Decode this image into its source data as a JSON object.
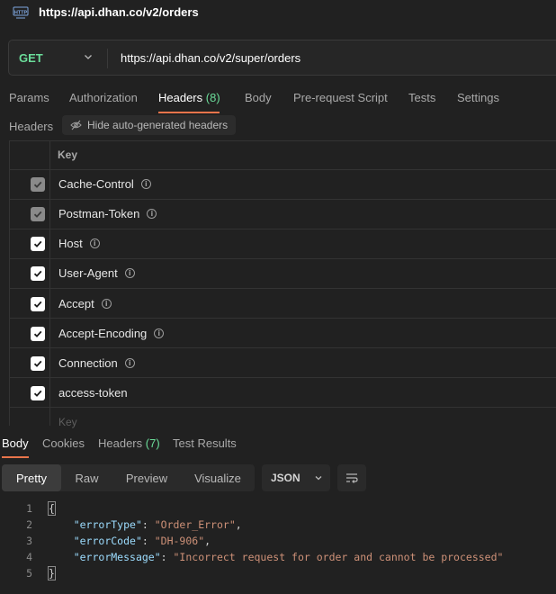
{
  "window": {
    "title": "https://api.dhan.co/v2/orders"
  },
  "request": {
    "method": "GET",
    "url": "https://api.dhan.co/v2/super/orders",
    "tabs": [
      {
        "label": "Params"
      },
      {
        "label": "Authorization"
      },
      {
        "label": "Headers",
        "count": "(8)"
      },
      {
        "label": "Body"
      },
      {
        "label": "Pre-request Script"
      },
      {
        "label": "Tests"
      },
      {
        "label": "Settings"
      }
    ],
    "active_tab": "Headers"
  },
  "headers_section": {
    "label": "Headers",
    "hide_button": "Hide auto-generated headers",
    "column_key": "Key",
    "rows": [
      {
        "key": "Cache-Control",
        "state": "dim",
        "info": true
      },
      {
        "key": "Postman-Token",
        "state": "dim",
        "info": true
      },
      {
        "key": "Host",
        "state": "on",
        "info": true
      },
      {
        "key": "User-Agent",
        "state": "on",
        "info": true
      },
      {
        "key": "Accept",
        "state": "on",
        "info": true
      },
      {
        "key": "Accept-Encoding",
        "state": "on",
        "info": true
      },
      {
        "key": "Connection",
        "state": "on",
        "info": true
      },
      {
        "key": "access-token",
        "state": "on",
        "info": false
      }
    ],
    "new_key_placeholder": "Key"
  },
  "response": {
    "tabs": [
      {
        "label": "Body"
      },
      {
        "label": "Cookies"
      },
      {
        "label": "Headers",
        "count": "(7)"
      },
      {
        "label": "Test Results"
      }
    ],
    "active_tab": "Body",
    "view_modes": [
      "Pretty",
      "Raw",
      "Preview",
      "Visualize"
    ],
    "active_view": "Pretty",
    "format": "JSON",
    "code_lines": [
      {
        "n": "1",
        "parts": [
          {
            "t": "{",
            "c": "brace"
          }
        ]
      },
      {
        "n": "2",
        "parts": [
          {
            "t": "    ",
            "c": ""
          },
          {
            "t": "\"errorType\"",
            "c": "k"
          },
          {
            "t": ": ",
            "c": ""
          },
          {
            "t": "\"Order_Error\"",
            "c": "s"
          },
          {
            "t": ",",
            "c": ""
          }
        ]
      },
      {
        "n": "3",
        "parts": [
          {
            "t": "    ",
            "c": ""
          },
          {
            "t": "\"errorCode\"",
            "c": "k"
          },
          {
            "t": ": ",
            "c": ""
          },
          {
            "t": "\"DH-906\"",
            "c": "s"
          },
          {
            "t": ",",
            "c": ""
          }
        ]
      },
      {
        "n": "4",
        "parts": [
          {
            "t": "    ",
            "c": ""
          },
          {
            "t": "\"errorMessage\"",
            "c": "k"
          },
          {
            "t": ": ",
            "c": ""
          },
          {
            "t": "\"Incorrect request for order and cannot be processed\"",
            "c": "s"
          }
        ]
      },
      {
        "n": "5",
        "parts": [
          {
            "t": "}",
            "c": "brace"
          }
        ]
      }
    ]
  },
  "icons": {
    "http": "http-icon",
    "chevron": "chevron-down-icon",
    "eye_off": "eye-off-icon",
    "info": "info-icon",
    "checkbox": "checkbox-icon",
    "wrap": "wrap-lines-icon"
  },
  "colors": {
    "accent": "#e8744b",
    "method": "#6bdd9a",
    "count": "#6bdd9a",
    "json_key": "#9cdcfe",
    "json_string": "#ce9178"
  }
}
